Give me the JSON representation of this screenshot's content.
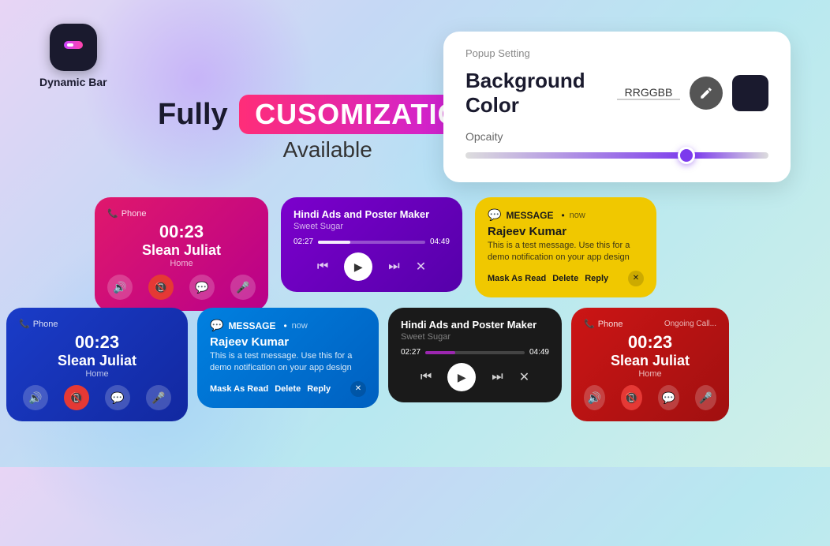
{
  "app": {
    "logo_label": "Dynamic Bar",
    "hero_fully": "Fully",
    "hero_customization": "CUSOMIZATION",
    "hero_available": "Available"
  },
  "popup": {
    "title": "Popup Setting",
    "bg_color_label": "Background Color",
    "hex_value": "RRGGBB",
    "opacity_label": "Opcaity",
    "slider_percent": 73
  },
  "cards": {
    "call_pink": {
      "header": "Phone",
      "time": "00:23",
      "name": "Slean Juliat",
      "sub": "Home"
    },
    "music_purple": {
      "title": "Hindi Ads and Poster Maker",
      "sub": "Sweet Sugar",
      "time_start": "02:27",
      "time_end": "04:49"
    },
    "msg_yellow": {
      "header": "MESSAGE",
      "when": "now",
      "name": "Rajeev Kumar",
      "body": "This is a test message. Use this for a demo notification on your app design",
      "btn1": "Mask As Read",
      "btn2": "Delete",
      "btn3": "Reply"
    },
    "call_blue": {
      "header": "Phone",
      "time": "00:23",
      "name": "Slean Juliat",
      "sub": "Home"
    },
    "msg_blue": {
      "header": "MESSAGE",
      "when": "now",
      "name": "Rajeev Kumar",
      "body": "This is a test message. Use this for a demo notification on your app design",
      "btn1": "Mask As Read",
      "btn2": "Delete",
      "btn3": "Reply"
    },
    "music_dark": {
      "title": "Hindi Ads and Poster Maker",
      "sub": "Sweet Sugar",
      "time_start": "02:27",
      "time_end": "04:49"
    },
    "call_red": {
      "header": "Phone",
      "ongoing": "Ongoing Call...",
      "time": "00:23",
      "name": "Slean Juliat",
      "sub": "Home"
    }
  }
}
